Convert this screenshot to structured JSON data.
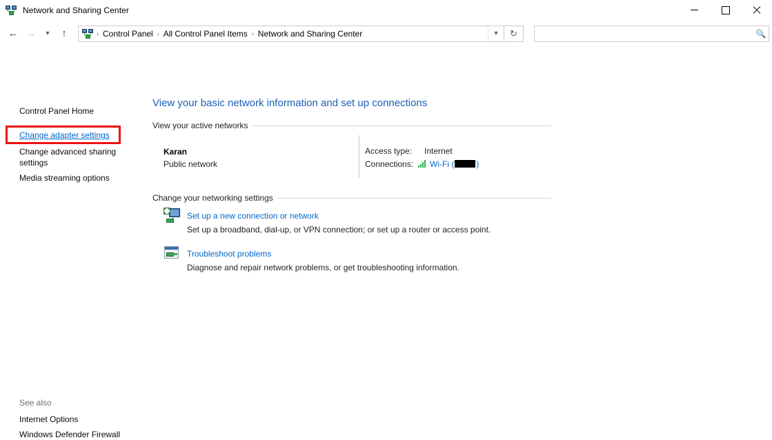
{
  "window": {
    "title": "Network and Sharing Center",
    "icon": "network-sharing-icon",
    "controls": {
      "minimize": "Minimize",
      "maximize": "Maximize",
      "close": "Close"
    }
  },
  "navbar": {
    "back": "Back",
    "forward": "Forward",
    "recent": "Recent locations",
    "up": "Up one level",
    "breadcrumbs": [
      {
        "label": "Control Panel"
      },
      {
        "label": "All Control Panel Items"
      },
      {
        "label": "Network and Sharing Center"
      }
    ],
    "separator": "›",
    "dropdown": "Previous locations",
    "refresh": "Refresh",
    "search": {
      "value": "",
      "placeholder": ""
    }
  },
  "sidebar": {
    "home_label": "Control Panel Home",
    "items": [
      {
        "label": "Change adapter settings",
        "highlighted": true
      },
      {
        "label": "Change advanced sharing settings",
        "highlighted": false
      },
      {
        "label": "Media streaming options",
        "highlighted": false
      }
    ],
    "see_also_label": "See also",
    "see_also_items": [
      {
        "label": "Internet Options"
      },
      {
        "label": "Windows Defender Firewall"
      }
    ]
  },
  "main": {
    "heading": "View your basic network information and set up connections",
    "active_networks": {
      "section_title": "View your active networks",
      "network_name": "Karan",
      "network_type": "Public network",
      "access_type_label": "Access type:",
      "access_type_value": "Internet",
      "connections_label": "Connections:",
      "connection_name": "Wi-Fi (",
      "connection_name_suffix": ")"
    },
    "networking_settings": {
      "section_title": "Change your networking settings",
      "tasks": [
        {
          "icon": "new-connection-icon",
          "link": "Set up a new connection or network",
          "description": "Set up a broadband, dial-up, or VPN connection; or set up a router or access point."
        },
        {
          "icon": "troubleshoot-icon",
          "link": "Troubleshoot problems",
          "description": "Diagnose and repair network problems, or get troubleshooting information."
        }
      ]
    }
  },
  "colors": {
    "link_blue": "#0066cc",
    "heading_blue": "#1a5fb4",
    "highlight_red": "#ee1111",
    "signal_green": "#2eae4e"
  }
}
